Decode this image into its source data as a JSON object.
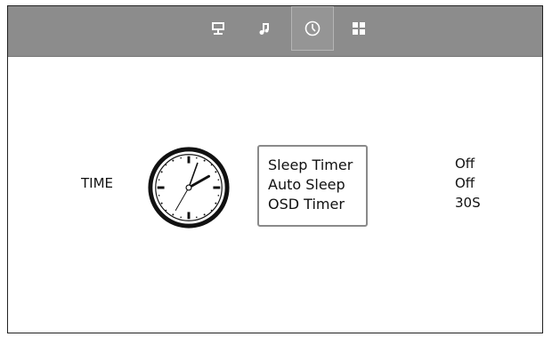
{
  "tabs": [
    {
      "icon": "monitor-icon",
      "selected": false
    },
    {
      "icon": "music-note-icon",
      "selected": false
    },
    {
      "icon": "clock-icon",
      "selected": true
    },
    {
      "icon": "grid-icon",
      "selected": false
    }
  ],
  "section_label": "TIME",
  "clock_illustration": {
    "icon": "analog-clock-icon"
  },
  "menu": {
    "items": [
      "Sleep Timer",
      "Auto Sleep",
      "OSD Timer"
    ]
  },
  "values": [
    "Off",
    "Off",
    "30S"
  ],
  "colors": {
    "top_bar": "#8c8c8c",
    "icon": "#ffffff",
    "menu_border": "#8a8a8a",
    "text": "#111111"
  }
}
